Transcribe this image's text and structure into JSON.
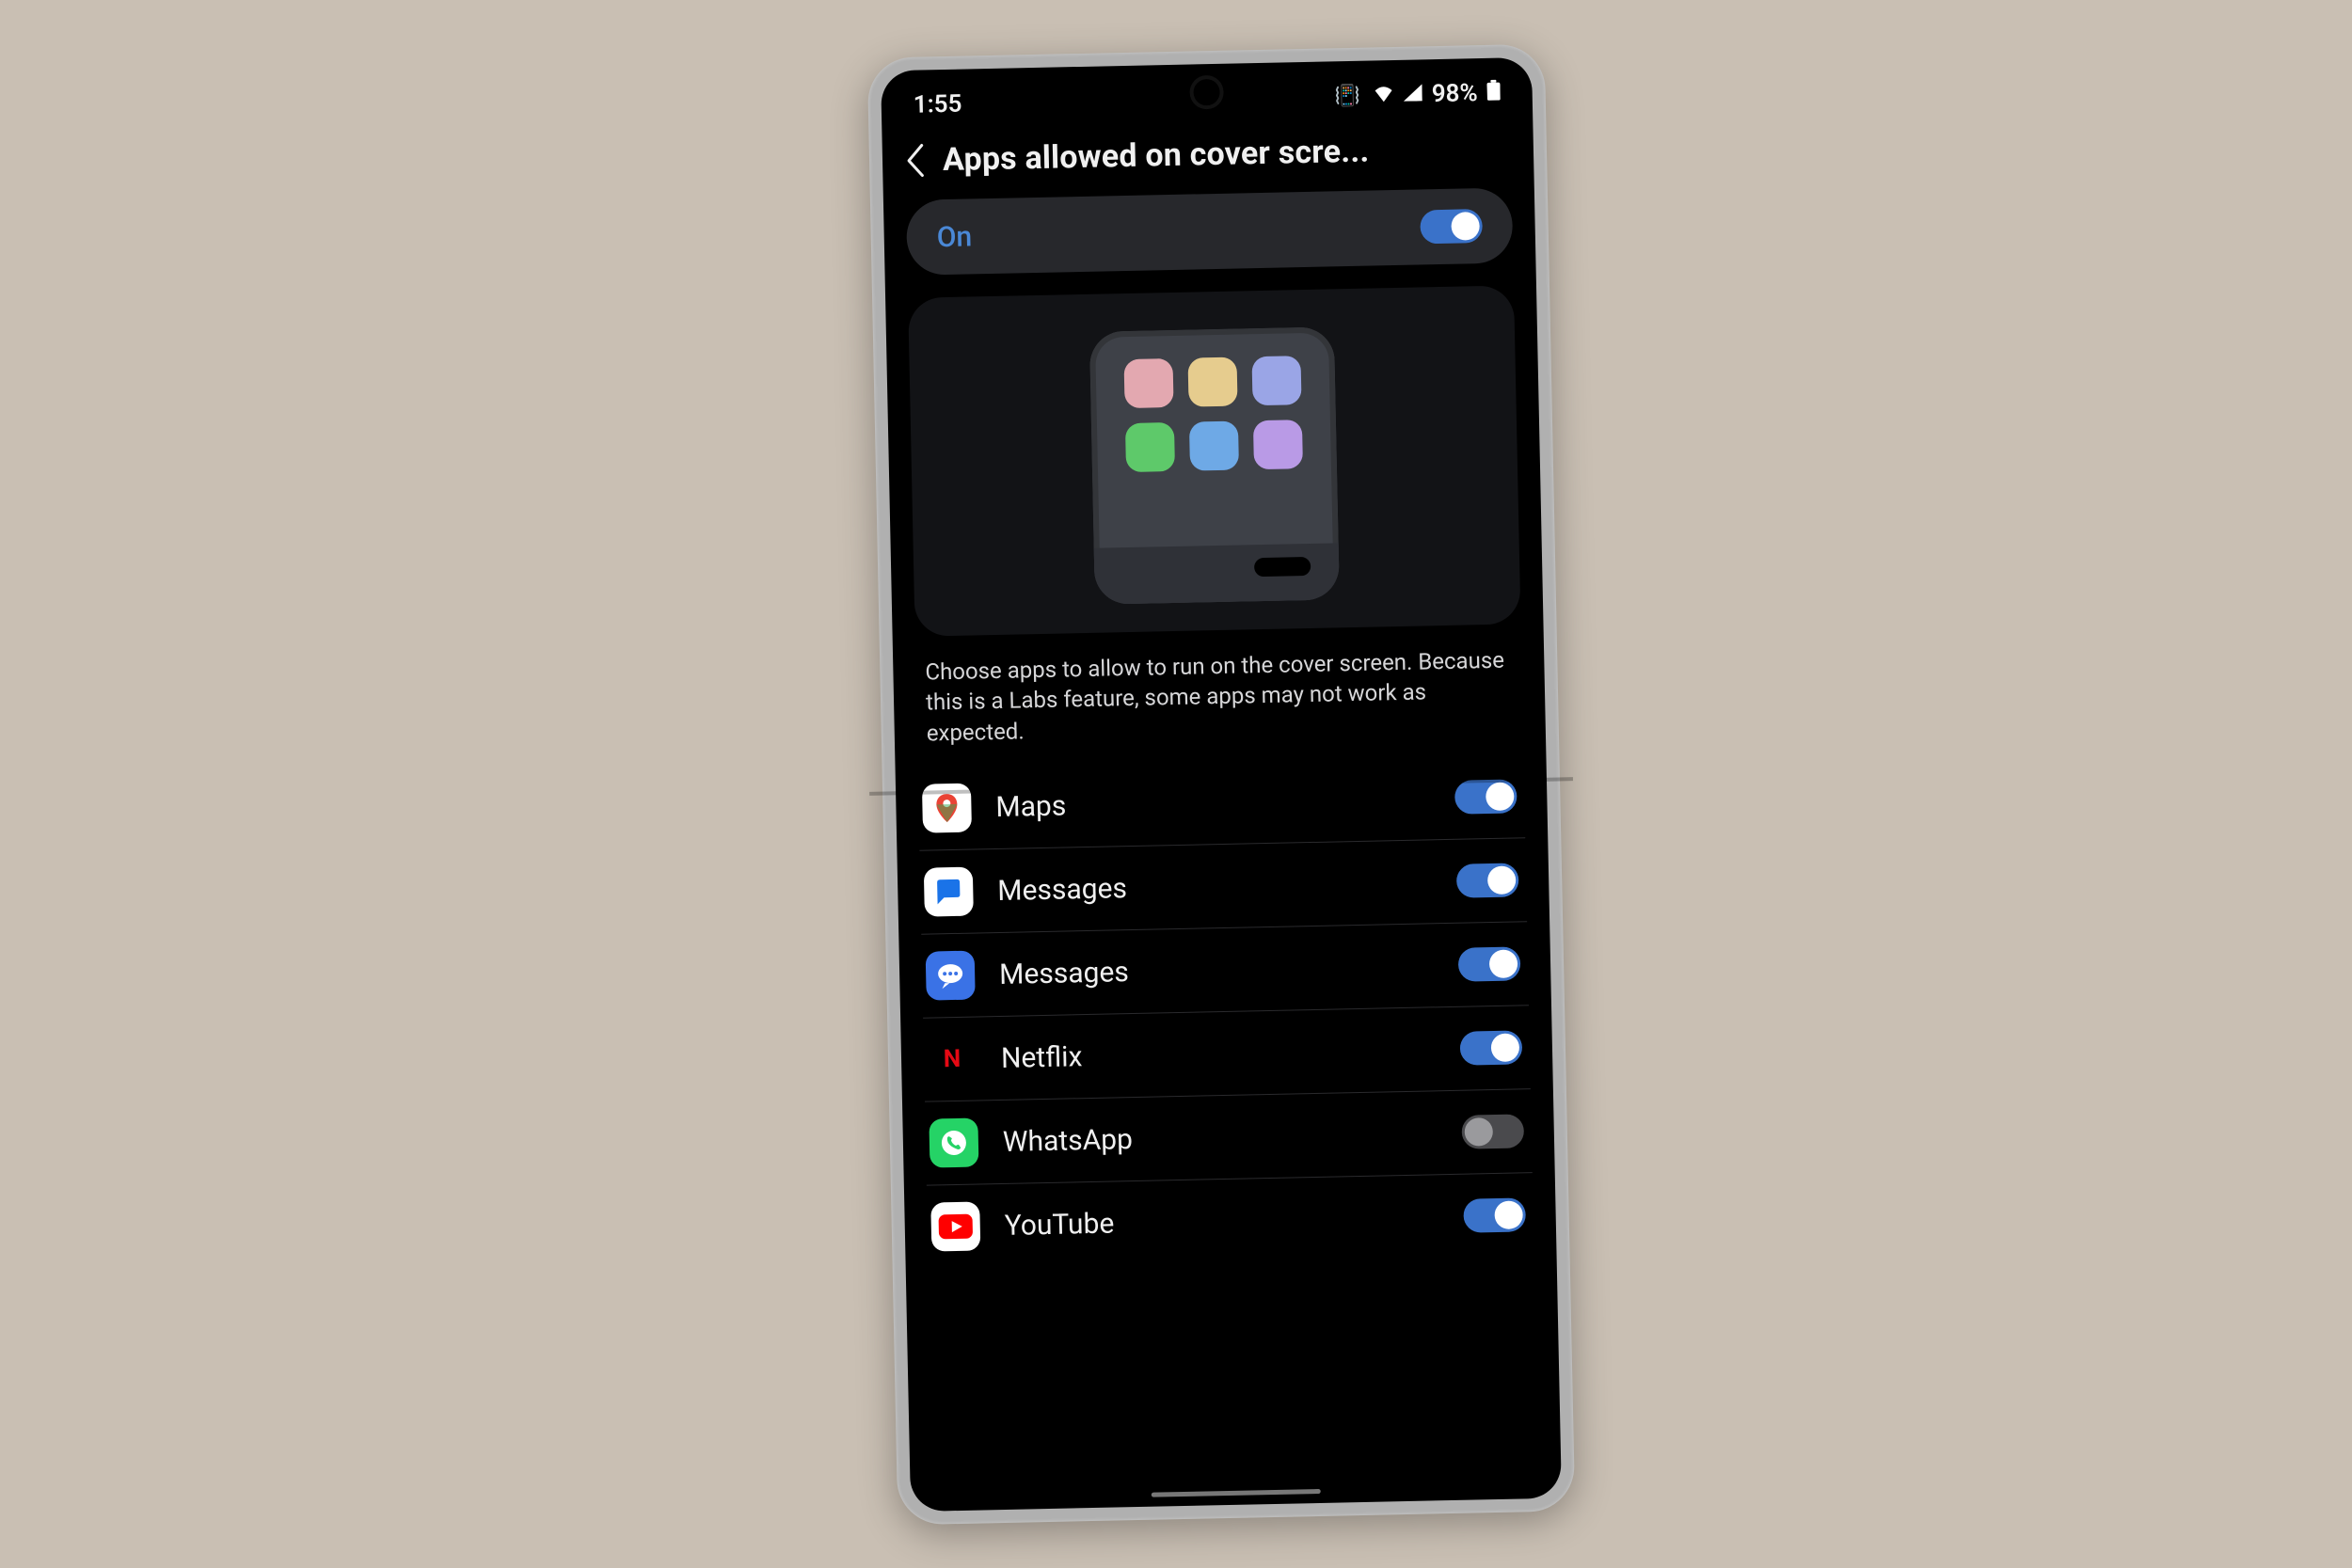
{
  "status_bar": {
    "time": "1:55",
    "battery_text": "98%"
  },
  "header": {
    "title": "Apps allowed on cover scre..."
  },
  "master_toggle": {
    "label": "On",
    "enabled": true
  },
  "description": "Choose apps to allow to run on the cover screen. Because this is a Labs feature, some apps may not work as expected.",
  "apps": [
    {
      "name": "Maps",
      "icon": "maps",
      "enabled": true
    },
    {
      "name": "Messages",
      "icon": "messages-google",
      "enabled": true
    },
    {
      "name": "Messages",
      "icon": "messages-samsung",
      "enabled": true
    },
    {
      "name": "Netflix",
      "icon": "netflix",
      "enabled": true
    },
    {
      "name": "WhatsApp",
      "icon": "whatsapp",
      "enabled": false
    },
    {
      "name": "YouTube",
      "icon": "youtube",
      "enabled": true
    }
  ],
  "colors": {
    "accent": "#3a72c9",
    "background": "#000000",
    "card": "#27282c"
  }
}
